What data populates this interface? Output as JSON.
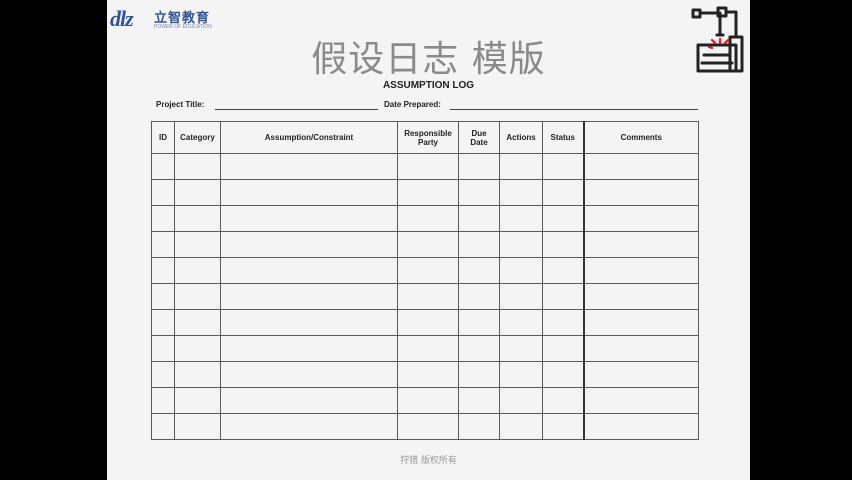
{
  "logo": {
    "mark": "dlz",
    "name_cn": "立智教育",
    "name_en": "POWER OF EDUCATION"
  },
  "slide_title": "假设日志 模版",
  "form": {
    "title": "ASSUMPTION LOG",
    "project_title_label": "Project Title:",
    "date_prepared_label": "Date Prepared:"
  },
  "table": {
    "headers": {
      "id": "ID",
      "category": "Category",
      "assumption": "Assumption/Constraint",
      "responsible_line1": "Responsible",
      "responsible_line2": "Party",
      "due_line1": "Due",
      "due_line2": "Date",
      "actions": "Actions",
      "status": "Status",
      "comments": "Comments"
    },
    "empty_rows": 11
  },
  "footer": "狩猎 版权所有",
  "icons": {
    "robot_arm": "robot-arm-icon"
  },
  "colors": {
    "brand_blue": "#2f5597",
    "title_gray": "#8a8a8a",
    "background": "#f4f4f4"
  }
}
